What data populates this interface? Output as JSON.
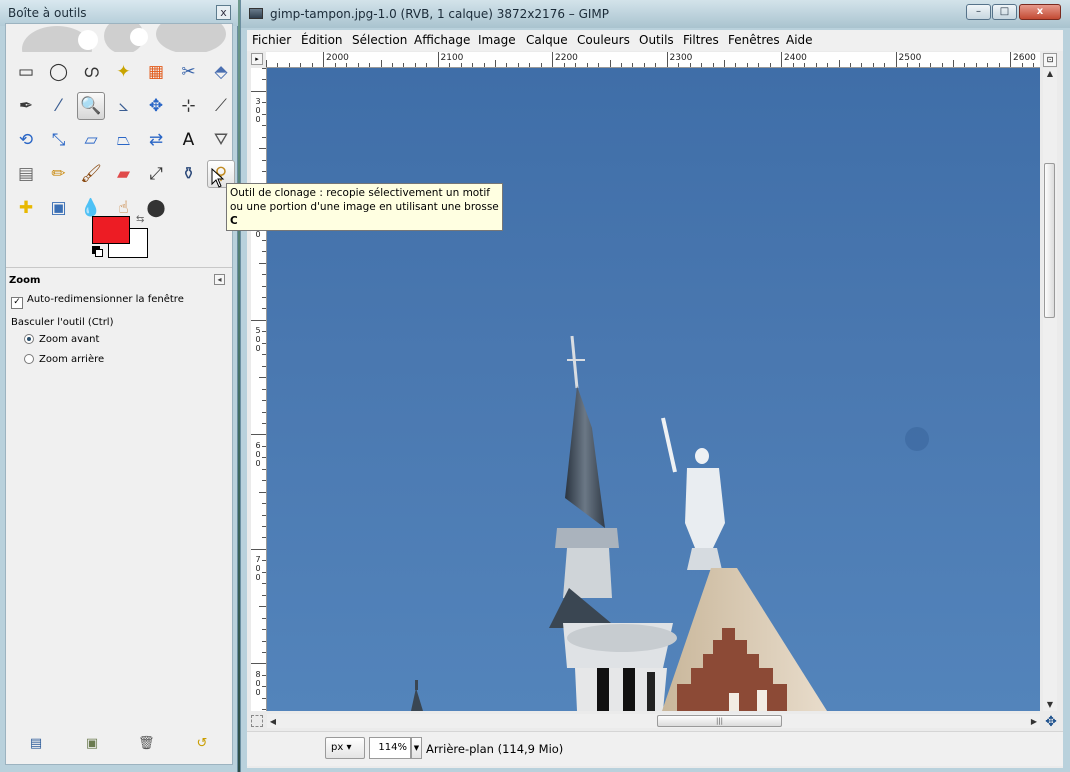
{
  "toolbox": {
    "title": "Boîte à outils",
    "close_label": "x",
    "tools": [
      {
        "name": "rect-select-icon",
        "glyph": "▭",
        "color": "#333"
      },
      {
        "name": "ellipse-select-icon",
        "glyph": "◯",
        "color": "#333"
      },
      {
        "name": "free-select-icon",
        "glyph": "ഗ",
        "color": "#333"
      },
      {
        "name": "fuzzy-select-icon",
        "glyph": "✦",
        "color": "#c9a400"
      },
      {
        "name": "color-select-icon",
        "glyph": "▦",
        "color": "#e25b1b"
      },
      {
        "name": "scissors-icon",
        "glyph": "✂",
        "color": "#3561a8"
      },
      {
        "name": "foreground-select-icon",
        "glyph": "⬘",
        "color": "#4a6fb1"
      },
      {
        "name": "paths-icon",
        "glyph": "✒",
        "color": "#3a3a3a"
      },
      {
        "name": "color-picker-icon",
        "glyph": "⁄",
        "color": "#3a5d92"
      },
      {
        "name": "zoom-icon",
        "glyph": "🔍",
        "color": "#3a5d92"
      },
      {
        "name": "measure-icon",
        "glyph": "⦣",
        "color": "#3a5d92"
      },
      {
        "name": "move-icon",
        "glyph": "✥",
        "color": "#2a66c6"
      },
      {
        "name": "align-icon",
        "glyph": "⊹",
        "color": "#333"
      },
      {
        "name": "crop-icon",
        "glyph": "⟋",
        "color": "#444"
      },
      {
        "name": "rotate-icon",
        "glyph": "⟲",
        "color": "#2a66c6"
      },
      {
        "name": "scale-icon",
        "glyph": "⤡",
        "color": "#2a66c6"
      },
      {
        "name": "shear-icon",
        "glyph": "▱",
        "color": "#2a66c6"
      },
      {
        "name": "perspective-icon",
        "glyph": "⏢",
        "color": "#2a66c6"
      },
      {
        "name": "flip-icon",
        "glyph": "⇄",
        "color": "#2a66c6"
      },
      {
        "name": "text-icon",
        "glyph": "A",
        "color": "#111"
      },
      {
        "name": "bucket-fill-icon",
        "glyph": "⛛",
        "color": "#555"
      },
      {
        "name": "blend-icon",
        "glyph": "▤",
        "color": "#666"
      },
      {
        "name": "pencil-icon",
        "glyph": "✏",
        "color": "#c98a10"
      },
      {
        "name": "paintbrush-icon",
        "glyph": "🖌",
        "color": "#8a4a12"
      },
      {
        "name": "eraser-icon",
        "glyph": "▰",
        "color": "#e04a4a"
      },
      {
        "name": "airbrush-icon",
        "glyph": "⤢",
        "color": "#333"
      },
      {
        "name": "ink-icon",
        "glyph": "⚱",
        "color": "#2d4a7a"
      },
      {
        "name": "clone-icon",
        "glyph": "⚲",
        "color": "#c08a20"
      },
      {
        "name": "heal-icon",
        "glyph": "✚",
        "color": "#e8b800"
      },
      {
        "name": "perspective-clone-icon",
        "glyph": "▣",
        "color": "#3a6fb5"
      },
      {
        "name": "blur-icon",
        "glyph": "💧",
        "color": "#3a7bc4"
      },
      {
        "name": "smudge-icon",
        "glyph": "☝",
        "color": "#c07020"
      },
      {
        "name": "dodge-burn-icon",
        "glyph": "⬤",
        "color": "#333"
      }
    ],
    "options_title": "Zoom",
    "auto_resize_label": "Auto-redimensionner la fenêtre",
    "toggle_label": "Basculer l'outil  (Ctrl)",
    "zoom_in_label": "Zoom avant",
    "zoom_out_label": "Zoom arrière"
  },
  "tooltip": {
    "line1": "Outil de clonage : recopie sélectivement un motif",
    "line2": "ou une portion d'une image en utilisant une brosse",
    "shortcut": "C"
  },
  "image_window": {
    "title": "gimp-tampon.jpg-1.0 (RVB, 1 calque) 3872x2176 – GIMP",
    "minimize": "–",
    "maximize": "□",
    "close": "x",
    "menus": [
      "Fichier",
      "Édition",
      "Sélection",
      "Affichage",
      "Image",
      "Calque",
      "Couleurs",
      "Outils",
      "Filtres",
      "Fenêtres",
      "Aide"
    ],
    "hruler_labels": [
      "2000",
      "2100",
      "2200",
      "2300",
      "2400",
      "2500",
      "2600"
    ],
    "vruler_labels": [
      "300",
      "400",
      "500",
      "600",
      "700",
      "800"
    ],
    "unit": "px",
    "zoom": "114%",
    "status": "Arrière-plan (114,9 Mio)"
  }
}
